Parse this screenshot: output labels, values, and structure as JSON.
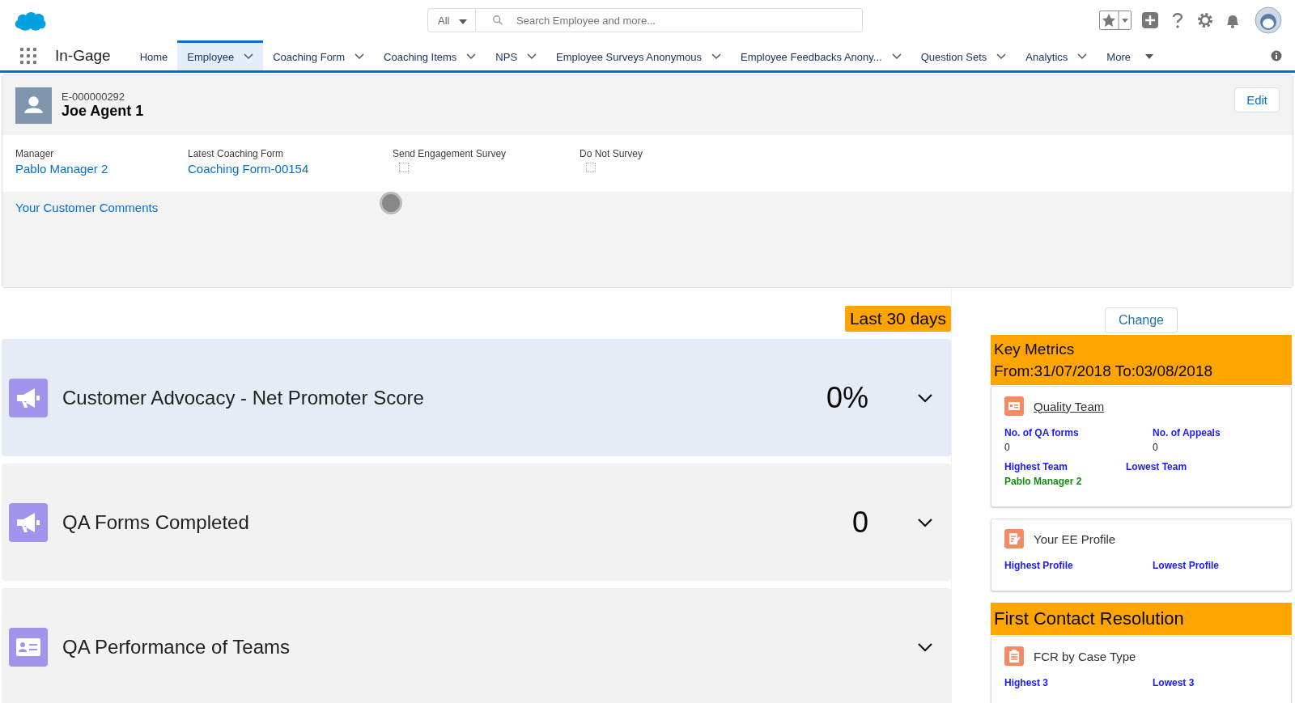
{
  "header": {
    "search_scope": "All",
    "search": {
      "placeholder": "Search Employee and more..."
    }
  },
  "nav": {
    "app_name": "In-Gage",
    "tabs": [
      {
        "label": "Home",
        "selected": false,
        "has_menu": false
      },
      {
        "label": "Employee",
        "selected": true,
        "has_menu": true
      },
      {
        "label": "Coaching Form",
        "selected": false,
        "has_menu": true
      },
      {
        "label": "Coaching Items",
        "selected": false,
        "has_menu": true
      },
      {
        "label": "NPS",
        "selected": false,
        "has_menu": true
      },
      {
        "label": "Employee Surveys Anonymous",
        "selected": false,
        "has_menu": true
      },
      {
        "label": "Employee Feedbacks Anony...",
        "selected": false,
        "has_menu": true
      },
      {
        "label": "Question Sets",
        "selected": false,
        "has_menu": true
      },
      {
        "label": "Analytics",
        "selected": false,
        "has_menu": true
      }
    ],
    "more": "More"
  },
  "record": {
    "number": "E-000000292",
    "name": "Joe Agent 1",
    "edit_button": "Edit",
    "fields": [
      {
        "label": "Manager",
        "kind": "link",
        "value": "Pablo Manager 2"
      },
      {
        "label": "Latest Coaching Form",
        "kind": "link",
        "value": "Coaching Form-00154"
      },
      {
        "label": "Send Engagement Survey",
        "kind": "checkbox",
        "checked": false
      },
      {
        "label": "Do Not Survey",
        "kind": "checkbox",
        "checked": false
      }
    ],
    "comments_link": "Your Customer Comments"
  },
  "period_badge": "Last 30 days",
  "panels": [
    {
      "kind": "megaphone",
      "title": "Customer Advocacy - Net Promoter Score",
      "value": "0%",
      "highlighted": true
    },
    {
      "kind": "megaphone",
      "title": "QA Forms Completed",
      "value": "0",
      "highlighted": false
    },
    {
      "kind": "contact",
      "title": "QA Performance of Teams",
      "highlighted": false
    }
  ],
  "right": {
    "change_button": "Change",
    "sections": [
      {
        "kind": "header",
        "lines": [
          "Key Metrics",
          "From:31/07/2018  To:03/08/2018"
        ]
      },
      {
        "kind": "team-card",
        "title": "Quality Team",
        "underlined": true,
        "rows": [
          [
            {
              "label": "No. of QA forms",
              "value": "0"
            },
            {
              "label": "No. of Appeals",
              "value": "0"
            }
          ],
          [
            {
              "label": "Highest Team",
              "value": "Pablo Manager 2"
            },
            {
              "label": "Lowest Team"
            }
          ]
        ]
      },
      {
        "kind": "profile-card",
        "title": "Your EE Profile",
        "underlined": false,
        "rows": [
          [
            {
              "label": "Highest Profile"
            },
            {
              "label": "Lowest Profile"
            }
          ]
        ]
      },
      {
        "kind": "header",
        "lines": [
          "First Contact Resolution"
        ]
      },
      {
        "kind": "case-card",
        "title": "FCR by Case Type",
        "underlined": false,
        "rows": [
          [
            {
              "label": "Highest 3"
            },
            {
              "label": "Lowest 3"
            }
          ]
        ]
      }
    ]
  }
}
